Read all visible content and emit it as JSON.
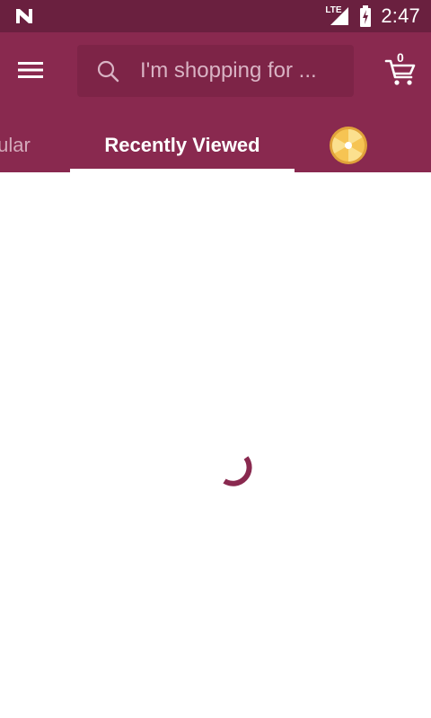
{
  "status_bar": {
    "network_label": "LTE",
    "time": "2:47"
  },
  "header": {
    "search": {
      "placeholder": "I'm shopping for ..."
    },
    "cart": {
      "count": "0"
    }
  },
  "tabs": [
    {
      "label": "Popular"
    },
    {
      "label": "Recently Viewed"
    },
    {
      "label": ""
    }
  ],
  "active_tab": "Recently Viewed",
  "loading": true,
  "colors": {
    "status_bar": "#6a203f",
    "app_bar": "#89294f",
    "search_box": "#7d2447",
    "inactive_tab": "#d4a9bb",
    "spinner": "#89294f",
    "wheel_gold": "#f2b53a"
  },
  "icons": {
    "status_left": "n-logo-icon",
    "signal": "signal-icon",
    "battery": "battery-charging-icon",
    "menu": "hamburger-icon",
    "search": "search-icon",
    "cart": "cart-icon",
    "wheel": "prize-wheel-icon"
  }
}
